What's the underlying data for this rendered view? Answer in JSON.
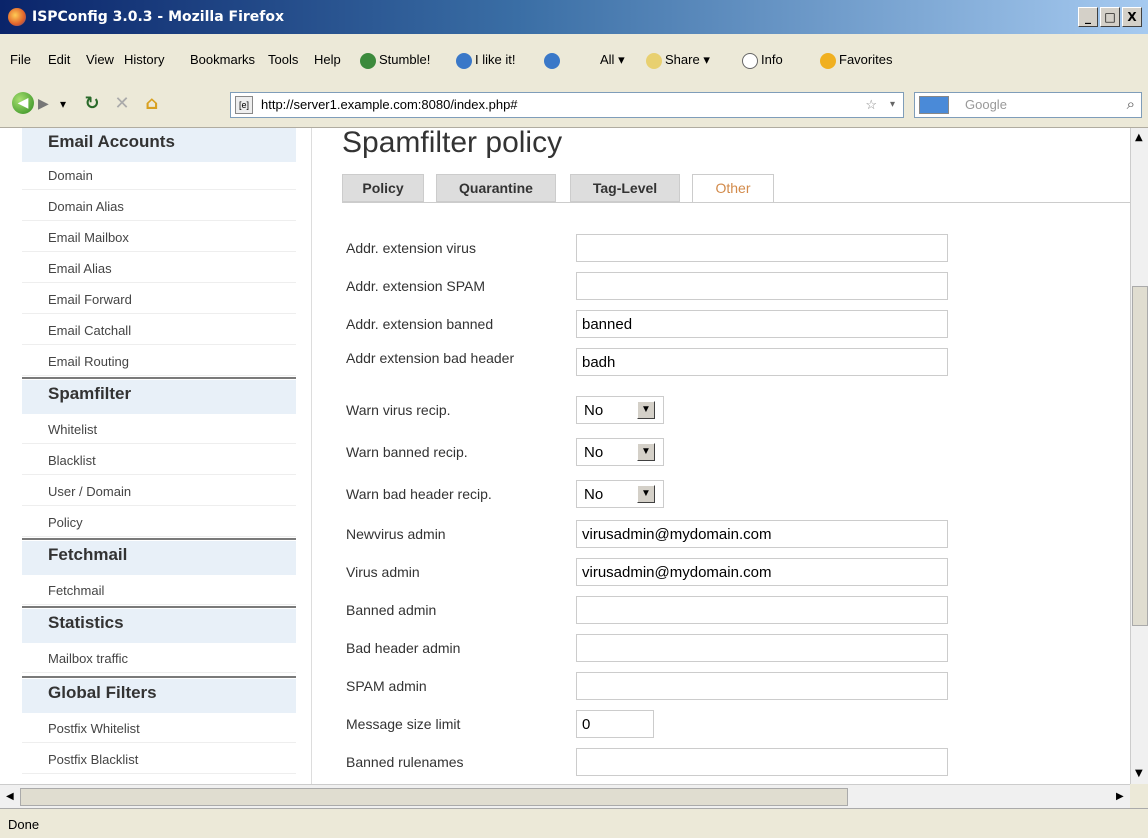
{
  "window": {
    "title": "ISPConfig 3.0.3 - Mozilla Firefox",
    "controls": [
      "_",
      "□",
      "X"
    ]
  },
  "menu": {
    "file": "File",
    "edit": "Edit",
    "view": "View",
    "history": "History",
    "bookmarks": "Bookmarks",
    "tools": "Tools",
    "help": "Help",
    "stumble": "Stumble!",
    "ilike": "I like it!",
    "all": "All",
    "share": "Share",
    "info": "Info",
    "favorites": "Favorites"
  },
  "nav": {
    "url": "http://server1.example.com:8080/index.php#",
    "search_placeholder": "Google"
  },
  "sidebar": {
    "email_heading": "Email Accounts",
    "email_items": [
      "Domain",
      "Domain Alias",
      "Email Mailbox",
      "Email Alias",
      "Email Forward",
      "Email Catchall",
      "Email Routing"
    ],
    "spam_heading": "Spamfilter",
    "spam_items": [
      "Whitelist",
      "Blacklist",
      "User / Domain",
      "Policy"
    ],
    "fetch_heading": "Fetchmail",
    "fetch_items": [
      "Fetchmail"
    ],
    "stats_heading": "Statistics",
    "stats_items": [
      "Mailbox traffic"
    ],
    "global_heading": "Global Filters",
    "global_items": [
      "Postfix Whitelist",
      "Postfix Blacklist"
    ]
  },
  "page": {
    "title": "Spamfilter policy"
  },
  "tabs": [
    {
      "label": "Policy"
    },
    {
      "label": "Quarantine"
    },
    {
      "label": "Tag-Level"
    },
    {
      "label": "Other",
      "active": true
    }
  ],
  "form": {
    "fields": [
      {
        "label": "Addr. extension virus",
        "value": ""
      },
      {
        "label": "Addr. extension SPAM",
        "value": ""
      },
      {
        "label": "Addr. extension banned",
        "value": "banned"
      },
      {
        "label": "Addr extension bad header",
        "value": "badh"
      },
      {
        "label": "Warn virus recip.",
        "value": "No"
      },
      {
        "label": "Warn banned recip.",
        "value": "No"
      },
      {
        "label": "Warn bad header recip.",
        "value": "No"
      },
      {
        "label": "Newvirus admin",
        "value": "virusadmin@mydomain.com"
      },
      {
        "label": "Virus admin",
        "value": "virusadmin@mydomain.com"
      },
      {
        "label": "Banned admin",
        "value": ""
      },
      {
        "label": "Bad header admin",
        "value": ""
      },
      {
        "label": "SPAM admin",
        "value": ""
      },
      {
        "label": "Message size limit",
        "value": "0"
      },
      {
        "label": "Banned rulenames",
        "value": ""
      }
    ]
  },
  "status": {
    "text": "Done"
  }
}
